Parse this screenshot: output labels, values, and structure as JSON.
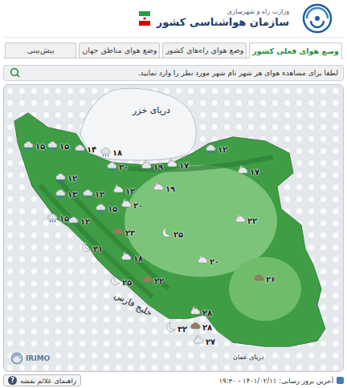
{
  "header": {
    "ministry": "وزارت راه و شهرسازی",
    "title": "سازمان هواشناسی کشور"
  },
  "tabs": [
    {
      "label": "وضع هوای فعلی کشور",
      "selected": true
    },
    {
      "label": "وضع هوای راه‌های کشور",
      "selected": false
    },
    {
      "label": "وضع هوای مناطق جهان",
      "selected": false
    },
    {
      "label": "پیش‌بینی",
      "selected": false
    }
  ],
  "search": {
    "placeholder": "لطفا برای مشاهده هوای هر شهر نام شهر مورد نظر را وارد نمایید."
  },
  "map": {
    "logo": "IRIMO",
    "labels": [
      {
        "text": "دریای خزر"
      },
      {
        "text": "خلیج فارس"
      },
      {
        "text": "دریای عمان"
      }
    ],
    "stations": [
      {
        "temp": "۱۵",
        "condition": "rain"
      },
      {
        "temp": "۱۵",
        "condition": "rain"
      },
      {
        "temp": "۱۴",
        "condition": "rain"
      },
      {
        "temp": "۱۸",
        "condition": "rain"
      },
      {
        "temp": "۲۰",
        "condition": "rain"
      },
      {
        "temp": "۱۹",
        "condition": "moon-cloud"
      },
      {
        "temp": "۱۷",
        "condition": "moon-cloud"
      },
      {
        "temp": "۱۲",
        "condition": "rain"
      },
      {
        "temp": "۱۷",
        "condition": "moon-cloud"
      },
      {
        "temp": "۱۹",
        "condition": "moon-cloud"
      },
      {
        "temp": "۱۲",
        "condition": "rain"
      },
      {
        "temp": "۱۳",
        "condition": "rain"
      },
      {
        "temp": "۱۲",
        "condition": "rain"
      },
      {
        "temp": "۱۲",
        "condition": "moon-cloud"
      },
      {
        "temp": "۲۰",
        "condition": "moon-cloud"
      },
      {
        "temp": "۱۵",
        "condition": "rain"
      },
      {
        "temp": "۱۵",
        "condition": "rain"
      },
      {
        "temp": "۱۲",
        "condition": "rain"
      },
      {
        "temp": "۲۳",
        "condition": "dust"
      },
      {
        "temp": "۲۵",
        "condition": "moon"
      },
      {
        "temp": "۲۲",
        "condition": "moon-cloud"
      },
      {
        "temp": "۲۱",
        "condition": "moon"
      },
      {
        "temp": "۱۸",
        "condition": "moon-cloud"
      },
      {
        "temp": "۲۰",
        "condition": "moon-cloud"
      },
      {
        "temp": "۲۵",
        "condition": "moon"
      },
      {
        "temp": "۲۲",
        "condition": "dust"
      },
      {
        "temp": "۲۶",
        "condition": "dust"
      },
      {
        "temp": "۲۸",
        "condition": "moon-cloud"
      },
      {
        "temp": "۲۸",
        "condition": "dust"
      },
      {
        "temp": "۳۲",
        "condition": "moon"
      },
      {
        "temp": "۲۷",
        "condition": "moon-cloud"
      }
    ]
  },
  "footer": {
    "legend_button": "راهنمای علائم نقشه",
    "help_icon": "?",
    "updated": "آخرین بروز رسانی: ۱۴۰۱/۰۲/۱۱ - ۱۹:۳۰"
  }
}
